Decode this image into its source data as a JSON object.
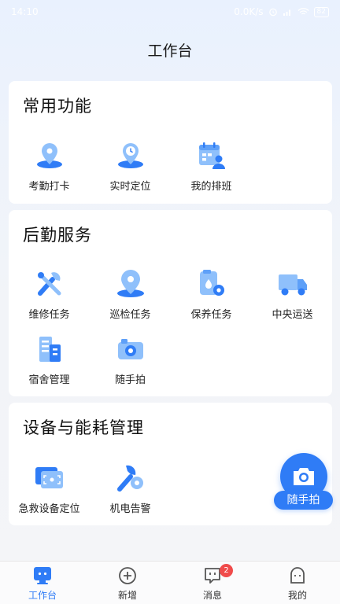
{
  "status_bar": {
    "time": "14:10",
    "net_speed": "0.0K/s",
    "battery": "82"
  },
  "header": {
    "title": "工作台"
  },
  "sections": [
    {
      "title": "常用功能",
      "items": [
        {
          "label": "考勤打卡",
          "icon": "location-pin-icon"
        },
        {
          "label": "实时定位",
          "icon": "clock-location-icon"
        },
        {
          "label": "我的排班",
          "icon": "calendar-user-icon"
        }
      ]
    },
    {
      "title": "后勤服务",
      "items": [
        {
          "label": "维修任务",
          "icon": "wrench-icon"
        },
        {
          "label": "巡检任务",
          "icon": "patrol-pin-icon"
        },
        {
          "label": "保养任务",
          "icon": "maintenance-icon"
        },
        {
          "label": "中央运送",
          "icon": "truck-icon"
        },
        {
          "label": "宿舍管理",
          "icon": "building-icon"
        },
        {
          "label": "随手拍",
          "icon": "camera-icon"
        }
      ]
    },
    {
      "title": "设备与能耗管理",
      "items": [
        {
          "label": "急救设备定位",
          "icon": "device-locate-icon"
        },
        {
          "label": "机电告警",
          "icon": "electromech-alarm-icon"
        }
      ]
    }
  ],
  "fab": {
    "label": "随手拍",
    "icon": "camera-icon"
  },
  "tabbar": [
    {
      "label": "工作台",
      "icon": "workbench-icon",
      "active": true
    },
    {
      "label": "新增",
      "icon": "add-circle-icon"
    },
    {
      "label": "消息",
      "icon": "message-icon",
      "badge": "2"
    },
    {
      "label": "我的",
      "icon": "profile-icon"
    }
  ],
  "colors": {
    "primary": "#2f7cf6",
    "icon_light": "#8fc0fb",
    "badge": "#f04b4b"
  }
}
